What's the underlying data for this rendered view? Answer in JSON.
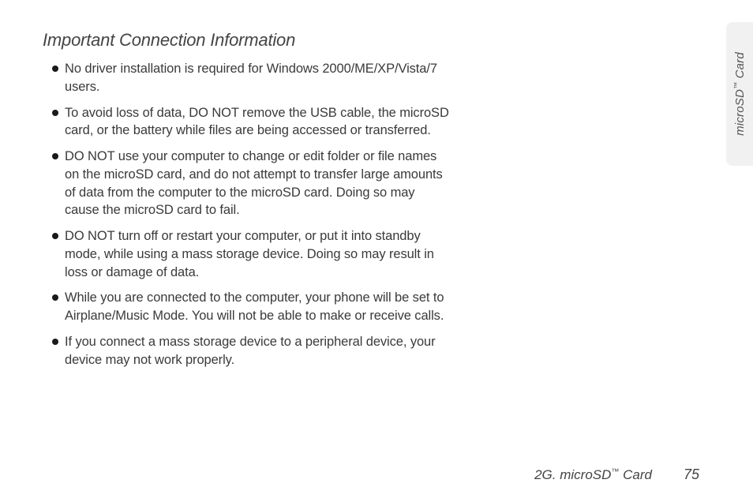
{
  "heading": "Important Connection Information",
  "bullets": [
    "No driver installation is required for Windows 2000/ME/XP/Vista/7 users.",
    "To avoid loss of data, DO NOT remove the USB cable, the microSD card, or the battery while files are being accessed or transferred.",
    "DO NOT use your computer to change or edit folder or file names on the microSD card, and do not attempt to transfer large amounts of data from the computer to the microSD card. Doing so may cause the microSD card to fail.",
    "DO NOT turn off or restart your computer, or put it into standby mode, while using a mass storage device. Doing so may result in loss or damage of data.",
    "While you are connected to the computer, your phone will be set to Airplane/Music Mode. You will not be able to make or receive calls.",
    "If you connect a mass storage device to a peripheral device, your device may not work properly."
  ],
  "sideTab": {
    "prefix": "microSD",
    "tm": "™",
    "suffix": " Card"
  },
  "footer": {
    "sectionPrefix": "2G. microSD",
    "sectionTm": "™",
    "sectionSuffix": " Card",
    "page": "75"
  }
}
